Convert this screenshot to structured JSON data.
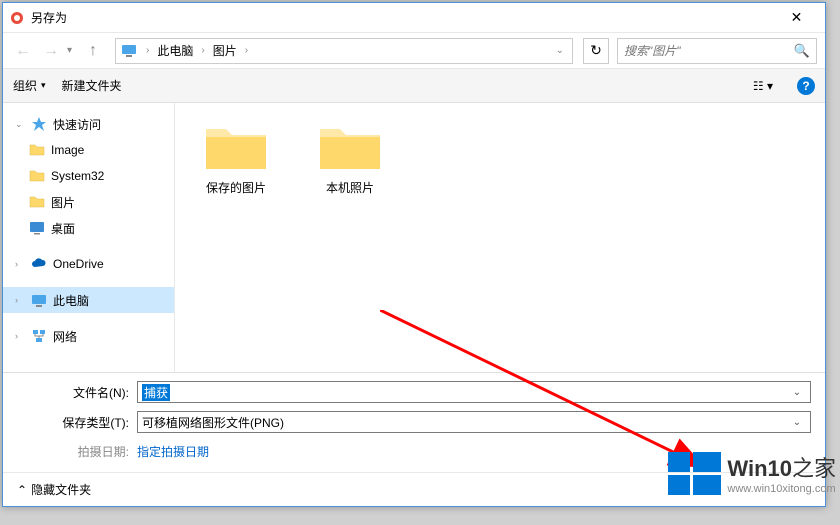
{
  "title": "另存为",
  "breadcrumb": {
    "root": "此电脑",
    "current": "图片"
  },
  "search": {
    "placeholder": "搜索\"图片\""
  },
  "toolbar": {
    "organize": "组织",
    "newfolder": "新建文件夹"
  },
  "sidebar": {
    "quick": "快速访问",
    "image": "Image",
    "system32": "System32",
    "pictures": "图片",
    "desktop": "桌面",
    "onedrive": "OneDrive",
    "thispc": "此电脑",
    "network": "网络"
  },
  "folders": [
    {
      "name": "保存的图片"
    },
    {
      "name": "本机照片"
    }
  ],
  "filename_label": "文件名(N):",
  "filename_value": "捕获",
  "filetype_label": "保存类型(T):",
  "filetype_value": "可移植网络图形文件(PNG)",
  "date_label": "拍摄日期:",
  "date_link": "指定拍摄日期",
  "hide_folders": "隐藏文件夹",
  "watermark": {
    "brand_a": "Win10",
    "brand_b": "之家",
    "url": "www.win10xitong.com"
  }
}
